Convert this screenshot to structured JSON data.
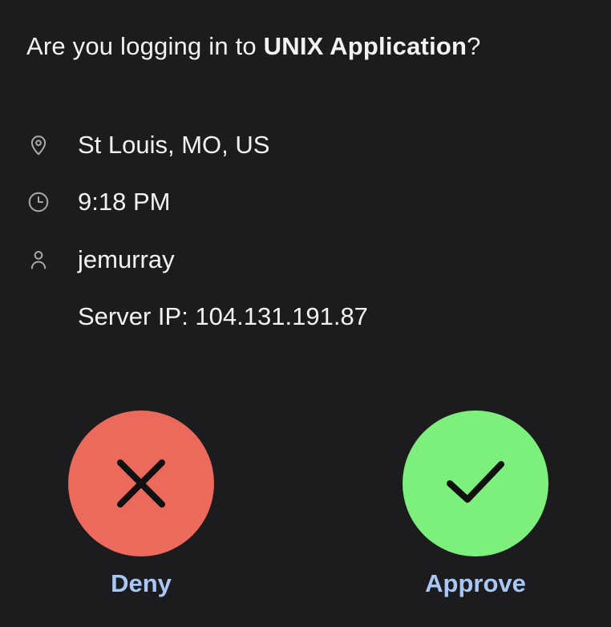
{
  "prompt": {
    "prefix": "Are you logging in to ",
    "app_name": "UNIX Application",
    "suffix": "?"
  },
  "details": {
    "location": {
      "icon": "location-pin-icon",
      "text": "St Louis, MO, US"
    },
    "time": {
      "icon": "clock-icon",
      "text": "9:18 PM"
    },
    "user": {
      "icon": "user-icon",
      "text": "jemurray"
    },
    "server": {
      "text": "Server IP: 104.131.191.87"
    }
  },
  "actions": {
    "deny": {
      "label": "Deny",
      "icon": "x-icon",
      "color": "#ec6a5c"
    },
    "approve": {
      "label": "Approve",
      "icon": "checkmark-icon",
      "color": "#7def7d"
    }
  },
  "colors": {
    "background": "#1c1c1e",
    "text": "#f2f2f2",
    "icon": "#a8a8a8",
    "action_label": "#a9c7f5"
  }
}
